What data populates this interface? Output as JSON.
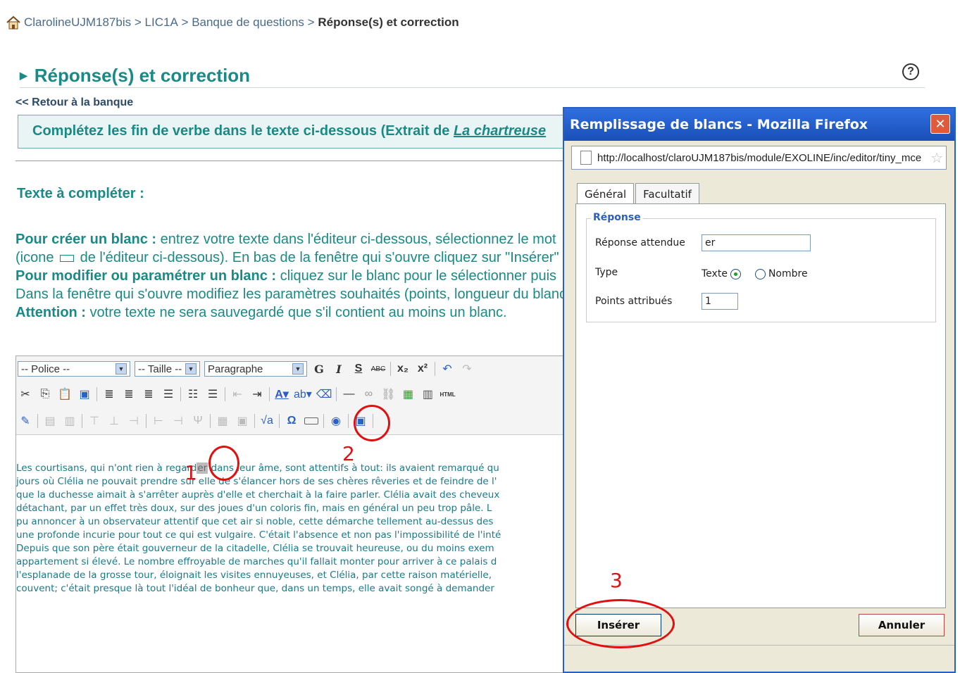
{
  "breadcrumb": {
    "items": [
      "ClarolineUJM187bis",
      "LIC1A",
      "Banque de questions"
    ],
    "separator": ">",
    "current": "Réponse(s) et correction"
  },
  "page": {
    "title": "Réponse(s) et correction",
    "back_link": "<< Retour à la banque",
    "instruction_prefix": "Complétez les fin de verbe dans le texte ci-dessous (Extrait de ",
    "instruction_title": "La chartreuse",
    "section_label": "Texte à compléter :"
  },
  "help": {
    "line1_bold": "Pour créer un blanc :",
    "line1_text": " entrez votre texte dans l'éditeur ci-dessous, sélectionnez le mot",
    "line2_pre": "(icone ",
    "line2_post": " de l'éditeur ci-dessous). En bas de la fenêtre qui s'ouvre cliquez sur \"Insérer\"",
    "line3_bold": "Pour modifier ou paramétrer un blanc :",
    "line3_text": " cliquez sur le blanc pour le sélectionner puis",
    "line4": "Dans la fenêtre qui s'ouvre modifiez les paramètres souhaités (points, longueur du blanc",
    "line5_bold": "Attention :",
    "line5_text": " votre texte ne sera sauvegardé que s'il contient au moins un blanc."
  },
  "toolbar": {
    "font_select": "-- Police --",
    "size_select": "-- Taille --",
    "format_select": "Paragraphe",
    "bold": "G",
    "italic": "I",
    "strike": "S",
    "spell": "ABC",
    "subscript": "x₂",
    "superscript": "x²",
    "html": "HTML"
  },
  "editor": {
    "line1_a": "Les courtisans, qui n'ont rien à regard",
    "blank": "er",
    "line1_b": " dans leur âme, sont attentifs à tout: ils avaient remarqué qu",
    "lines": [
      "jours où Clélia ne pouvait prendre sur elle de s'élancer hors de ses chères rêveries et de feindre de l'",
      "que la duchesse aimait à s'arrêter auprès d'elle et cherchait à la faire parler. Clélia avait des cheveux",
      "détachant, par un effet très doux, sur des joues d'un coloris fin, mais en général un peu trop pâle. L",
      "pu annoncer à un observateur attentif que cet air si noble, cette démarche tellement au-dessus des",
      "une profonde incurie pour tout ce qui est vulgaire. C'était l'absence et non pas l'impossibilité de l'inté",
      "Depuis que son père était gouverneur de la citadelle, Clélia se trouvait heureuse, ou du moins exem",
      "appartement si élevé. Le nombre effroyable de marches qu'il fallait monter pour arriver à ce palais d",
      "l'esplanade de la grosse tour, éloignait les visites ennuyeuses, et Clélia, par cette raison matérielle,",
      "couvent; c'était presque là tout l'idéal de bonheur que, dans un temps, elle avait songé à demander"
    ]
  },
  "annotations": [
    "1",
    "2",
    "3"
  ],
  "popup": {
    "title": "Remplissage de blancs - Mozilla Firefox",
    "url": "http://localhost/claroUJM187bis/module/EXOLINE/inc/editor/tiny_mce",
    "tabs": [
      "Général",
      "Facultatif"
    ],
    "legend": "Réponse",
    "answer_label": "Réponse attendue",
    "answer_value": "er",
    "type_label": "Type",
    "type_options": [
      "Texte",
      "Nombre"
    ],
    "type_selected": "Texte",
    "points_label": "Points attribués",
    "points_value": "1",
    "insert_button": "Insérer",
    "cancel_button": "Annuler"
  },
  "colors": {
    "accent": "#1a8a86",
    "annotation": "#e01010",
    "titlebar": "#2f6fe0"
  }
}
